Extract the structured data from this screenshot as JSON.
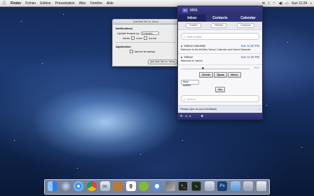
{
  "menubar": {
    "apple": "",
    "items": [
      "Finder",
      "Fichier",
      "Edition",
      "Présentation",
      "Aller",
      "Fenêtre",
      "Aide"
    ],
    "clock": "Sun 11:24"
  },
  "prefs": {
    "title": "Quit Mail Tab for Yahoo",
    "notifications_heading": "Notifications",
    "update_frequency_label": "Update frequency",
    "update_frequency_value": "5 minutes",
    "alerts_label": "Alerts",
    "alerts_none": "none",
    "alerts_sound": "sound",
    "application_heading": "Application",
    "launch_at_startup": "launch at startup",
    "quit_button": "Quit Mail Tab for Yahoo"
  },
  "mail": {
    "header_logo": "Y!",
    "header_title": "MAIL",
    "tabs": [
      "Inbox",
      "Contacts",
      "Calendar"
    ],
    "actions": [
      "Folders",
      "Refresh",
      "Compose"
    ],
    "search_placeholder": "Search Mail",
    "messages": [
      {
        "from": "Yahoo! Calendar",
        "date": "Sun 11:30 PM",
        "subject": "Welcome to the All-New Yahoo! Calendar and Yahoo! Notepad"
      },
      {
        "from": "Yahoo!",
        "date": "Sun 11:26 PM",
        "subject": "Welcome to Yahoo!"
      }
    ],
    "slider_label": "Skim",
    "buttons": [
      "Delete",
      "Spam",
      "Move"
    ],
    "more_actions": "More actions",
    "go_button": "Go",
    "search2_placeholder": "Search",
    "feedback": "Please give us your feedback"
  },
  "dock": {
    "icons": [
      "finder-icon",
      "launchpad-icon",
      "safari-icon",
      "chrome-icon",
      "mail-icon",
      "contacts-icon",
      "calendar-icon",
      "spotify-icon",
      "itunes-icon",
      "photos-icon",
      "terminal-icon",
      "activity-icon",
      "preview-icon",
      "photoshop-icon",
      "folder-icon",
      "downloads-icon",
      "trash-icon"
    ],
    "calendar_day": "9"
  }
}
